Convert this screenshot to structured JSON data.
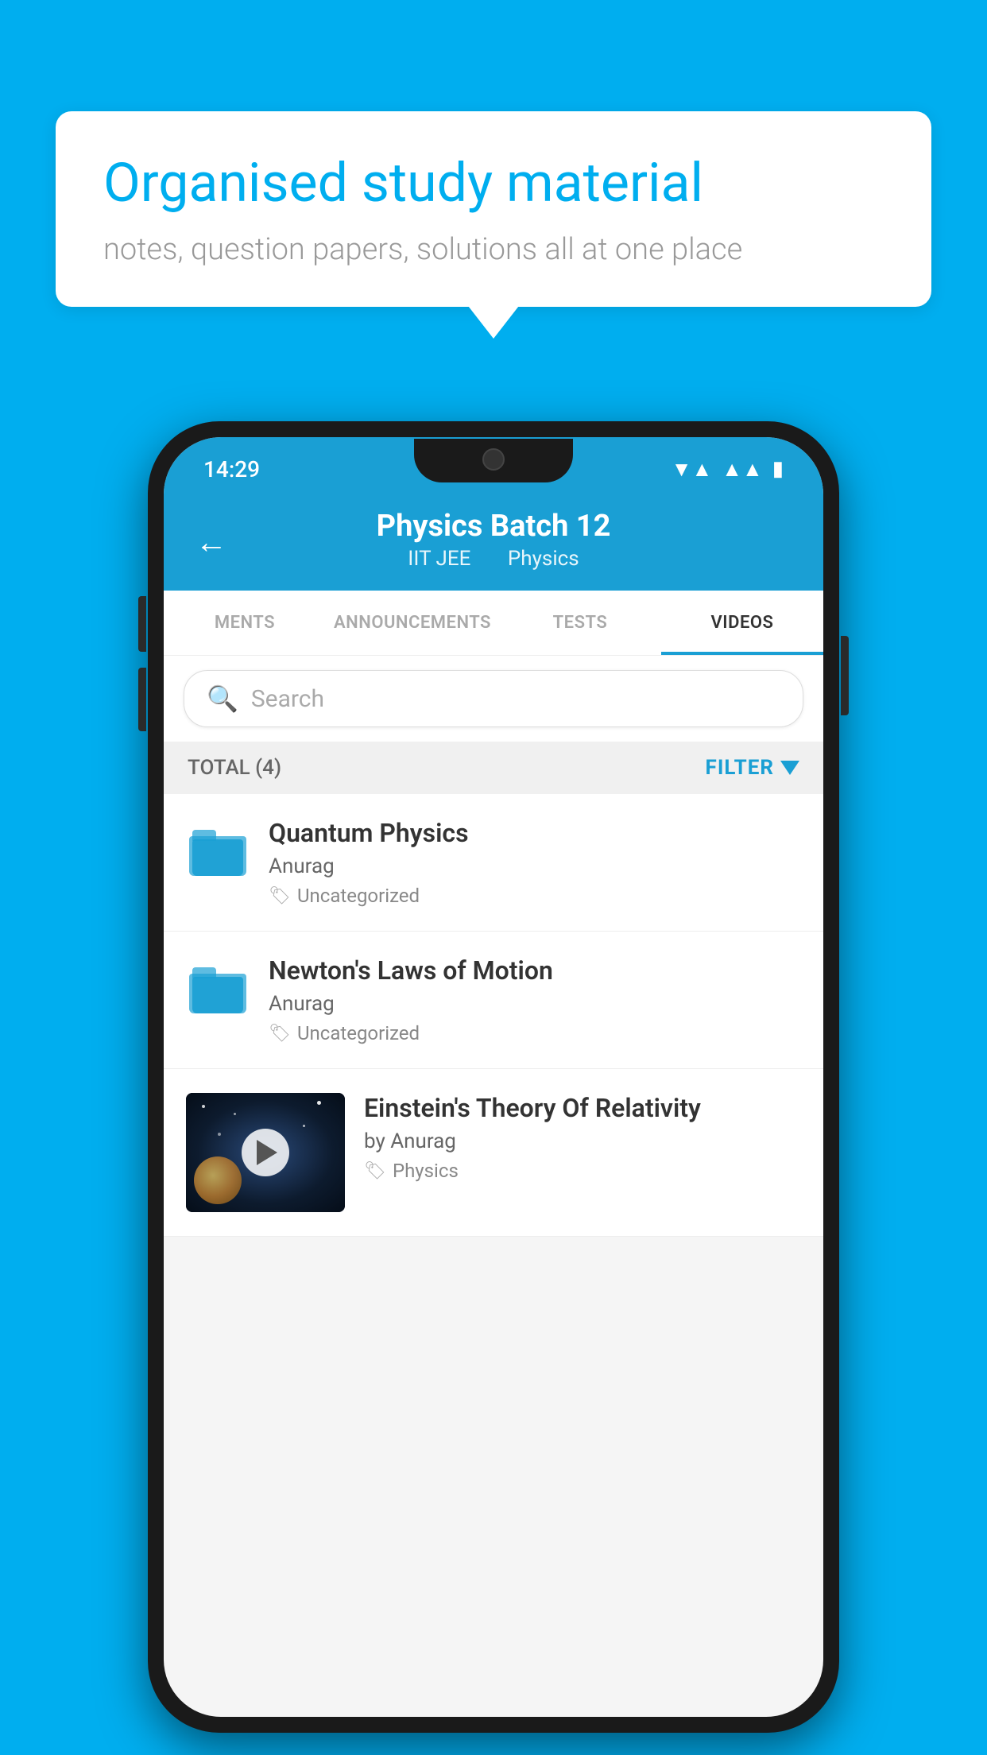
{
  "background_color": "#00AEEF",
  "speech_bubble": {
    "title": "Organised study material",
    "subtitle": "notes, question papers, solutions all at one place"
  },
  "phone": {
    "status_bar": {
      "time": "14:29",
      "wifi": "▼▲",
      "signal": "▲▲",
      "battery": "▮"
    },
    "header": {
      "title": "Physics Batch 12",
      "subtitle1": "IIT JEE",
      "subtitle2": "Physics",
      "back_label": "←"
    },
    "tabs": [
      {
        "label": "MENTS",
        "active": false
      },
      {
        "label": "ANNOUNCEMENTS",
        "active": false
      },
      {
        "label": "TESTS",
        "active": false
      },
      {
        "label": "VIDEOS",
        "active": true
      }
    ],
    "search": {
      "placeholder": "Search"
    },
    "filter_bar": {
      "total_label": "TOTAL (4)",
      "filter_label": "FILTER"
    },
    "video_items": [
      {
        "title": "Quantum Physics",
        "author": "Anurag",
        "tag": "Uncategorized",
        "has_thumbnail": false
      },
      {
        "title": "Newton's Laws of Motion",
        "author": "Anurag",
        "tag": "Uncategorized",
        "has_thumbnail": false
      },
      {
        "title": "Einstein's Theory Of Relativity",
        "author": "by Anurag",
        "tag": "Physics",
        "has_thumbnail": true
      }
    ]
  }
}
